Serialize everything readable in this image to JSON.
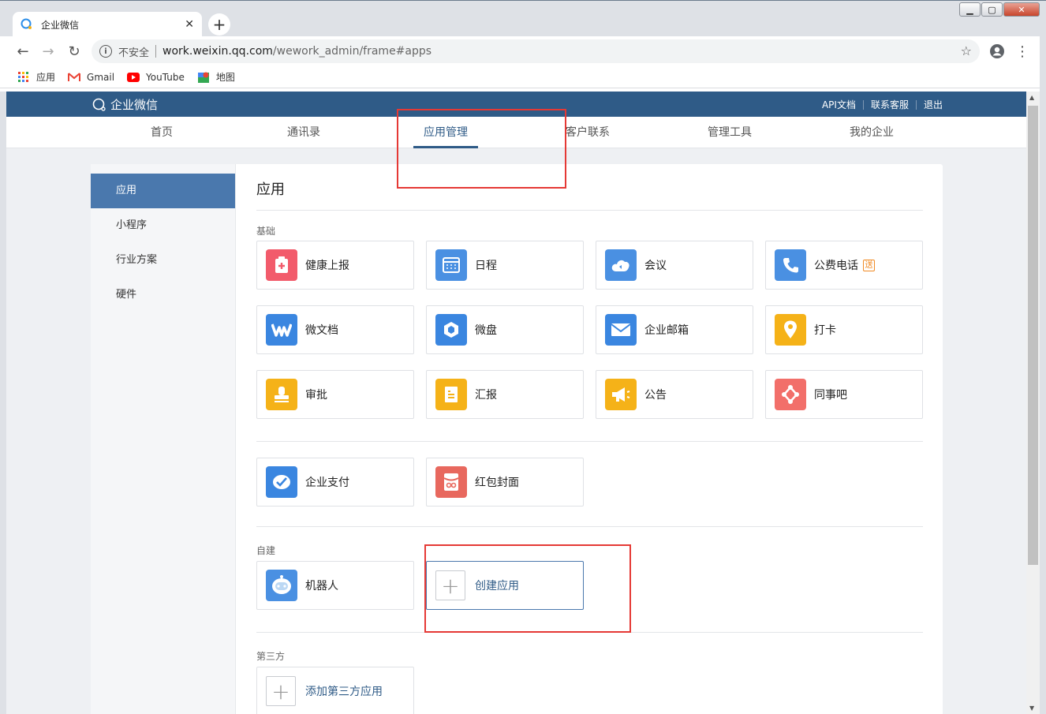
{
  "browser": {
    "tab_title": "企业微信",
    "insecure_label": "不安全",
    "url_host": "work.weixin.qq.com",
    "url_path": "/wework_admin/frame#apps",
    "bookmarks": [
      {
        "label": "应用",
        "icon": "apps-grid-icon"
      },
      {
        "label": "Gmail",
        "icon": "gmail-icon"
      },
      {
        "label": "YouTube",
        "icon": "youtube-icon"
      },
      {
        "label": "地图",
        "icon": "maps-icon"
      }
    ]
  },
  "header": {
    "logo_text": "企业微信",
    "links": [
      "API文档",
      "联系客服",
      "退出"
    ]
  },
  "nav": {
    "items": [
      "首页",
      "通讯录",
      "应用管理",
      "客户联系",
      "管理工具",
      "我的企业"
    ],
    "active": "应用管理"
  },
  "sidebar": {
    "items": [
      "应用",
      "小程序",
      "行业方案",
      "硬件"
    ]
  },
  "content": {
    "title": "应用",
    "basic_label": "基础",
    "basic_apps": [
      {
        "name": "健康上报",
        "icon": "health-report-icon",
        "color": "#f25b6b"
      },
      {
        "name": "日程",
        "icon": "calendar-icon",
        "color": "#4a90e2"
      },
      {
        "name": "会议",
        "icon": "meeting-icon",
        "color": "#4a90e2"
      },
      {
        "name": "公费电话",
        "icon": "phone-icon",
        "color": "#4a90e2",
        "badge": "送"
      },
      {
        "name": "微文档",
        "icon": "doc-icon",
        "color": "#3a86e0"
      },
      {
        "name": "微盘",
        "icon": "drive-icon",
        "color": "#3a86e0"
      },
      {
        "name": "企业邮箱",
        "icon": "mail-icon",
        "color": "#3a86e0"
      },
      {
        "name": "打卡",
        "icon": "checkin-icon",
        "color": "#f5b218"
      },
      {
        "name": "审批",
        "icon": "approval-icon",
        "color": "#f5b218"
      },
      {
        "name": "汇报",
        "icon": "report-icon",
        "color": "#f5b218"
      },
      {
        "name": "公告",
        "icon": "announcement-icon",
        "color": "#f5b218"
      },
      {
        "name": "同事吧",
        "icon": "colleague-icon",
        "color": "#f26f6a"
      }
    ],
    "pay_apps": [
      {
        "name": "企业支付",
        "icon": "pay-icon",
        "color": "#3a86e0"
      },
      {
        "name": "红包封面",
        "icon": "red-packet-icon",
        "color": "#e8685e"
      }
    ],
    "custom_label": "自建",
    "custom_apps": [
      {
        "name": "机器人",
        "icon": "robot-icon",
        "color": "#4a90e2"
      }
    ],
    "create_label": "创建应用",
    "third_label": "第三方",
    "add_third_label": "添加第三方应用"
  },
  "colors": {
    "header_bg": "#2f5b87",
    "sidebar_active": "#4a78ad",
    "annotation": "#e53935"
  }
}
